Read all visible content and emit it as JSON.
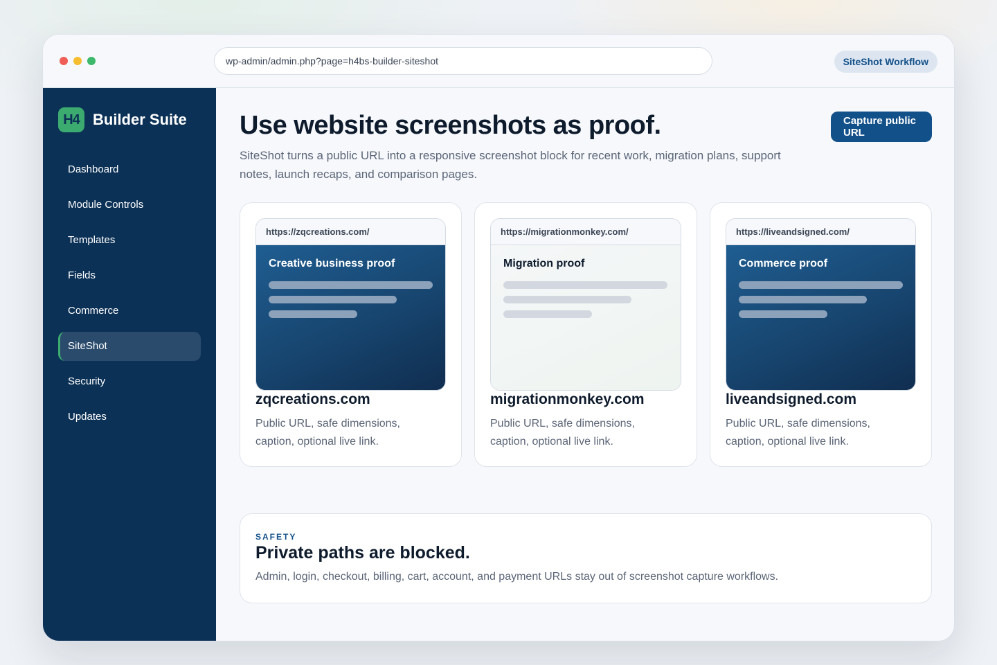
{
  "browser": {
    "url": "wp-admin/admin.php?page=h4bs-builder-siteshot",
    "workflow_label": "SiteShot Workflow"
  },
  "sidebar": {
    "logo_text": "H4",
    "brand_name": "Builder Suite",
    "items": [
      {
        "label": "Dashboard",
        "active": false
      },
      {
        "label": "Module Controls",
        "active": false
      },
      {
        "label": "Templates",
        "active": false
      },
      {
        "label": "Fields",
        "active": false
      },
      {
        "label": "Commerce",
        "active": false
      },
      {
        "label": "SiteShot",
        "active": true
      },
      {
        "label": "Security",
        "active": false
      },
      {
        "label": "Updates",
        "active": false
      }
    ]
  },
  "main": {
    "title": "Use website screenshots as proof.",
    "description": "SiteShot turns a public URL into a responsive screenshot block for recent work, migration plans, support notes, launch recaps, and comparison pages.",
    "capture_button": "Capture public URL",
    "cards": [
      {
        "url": "https://zqcreations.com/",
        "preview_title": "Creative business proof",
        "theme": "dark",
        "domain": "zqcreations.com",
        "caption": "Public URL, safe dimensions, caption, optional live link."
      },
      {
        "url": "https://migrationmonkey.com/",
        "preview_title": "Migration proof",
        "theme": "light",
        "domain": "migrationmonkey.com",
        "caption": "Public URL, safe dimensions, caption, optional live link."
      },
      {
        "url": "https://liveandsigned.com/",
        "preview_title": "Commerce proof",
        "theme": "dark",
        "domain": "liveandsigned.com",
        "caption": "Public URL, safe dimensions, caption, optional live link."
      }
    ],
    "safety": {
      "eyebrow": "SAFETY",
      "title": "Private paths are blocked.",
      "text": "Admin, login, checkout, billing, cart, account, and payment URLs stay out of screenshot capture workflows."
    }
  },
  "colors": {
    "sidebar_bg": "#0c3156",
    "accent_green": "#3cab6f",
    "primary_blue": "#12508a"
  }
}
